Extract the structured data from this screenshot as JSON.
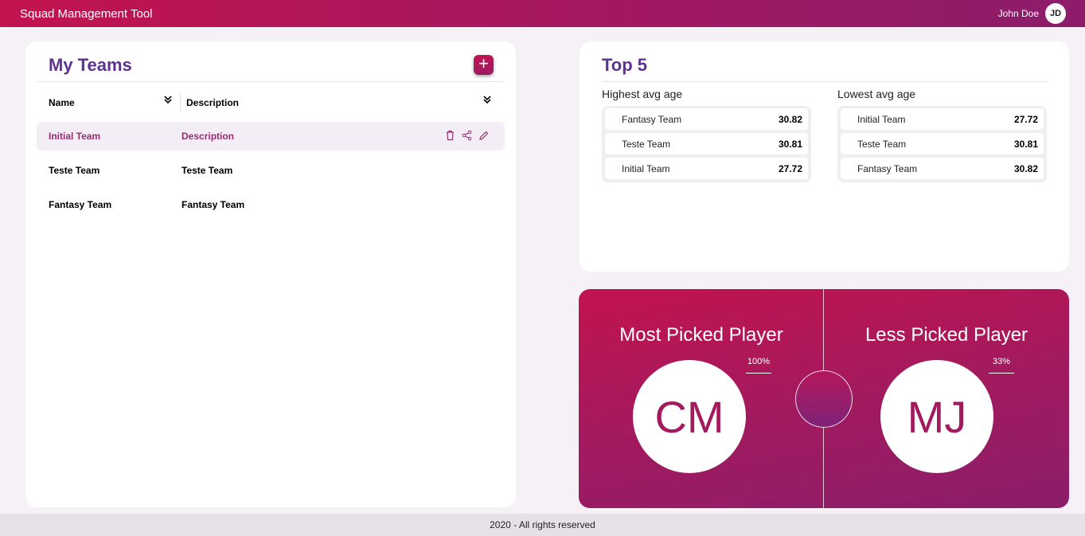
{
  "header": {
    "app_title": "Squad Management Tool",
    "user_name": "John Doe",
    "user_initials": "JD"
  },
  "my_teams": {
    "title": "My Teams",
    "add_label": "+",
    "columns": [
      "Name",
      "Description"
    ],
    "rows": [
      {
        "name": "Initial Team",
        "description": "Description"
      },
      {
        "name": "Teste Team",
        "description": "Teste Team"
      },
      {
        "name": "Fantasy Team",
        "description": "Fantasy Team"
      }
    ]
  },
  "top5": {
    "title": "Top 5",
    "highest": {
      "label": "Highest avg age",
      "items": [
        {
          "name": "Fantasy Team",
          "value": "30.82"
        },
        {
          "name": "Teste Team",
          "value": "30.81"
        },
        {
          "name": "Initial Team",
          "value": "27.72"
        }
      ]
    },
    "lowest": {
      "label": "Lowest avg age",
      "items": [
        {
          "name": "Initial Team",
          "value": "27.72"
        },
        {
          "name": "Teste Team",
          "value": "30.81"
        },
        {
          "name": "Fantasy Team",
          "value": "30.82"
        }
      ]
    }
  },
  "picked": {
    "most": {
      "title": "Most Picked Player",
      "initials": "CM",
      "percent": "100%"
    },
    "less": {
      "title": "Less Picked Player",
      "initials": "MJ",
      "percent": "33%"
    }
  },
  "footer": {
    "text": "2020 - All rights reserved"
  },
  "colors": {
    "accent": "#c2134f",
    "accent_dark": "#8c1c6b",
    "title_purple": "#5e3291"
  },
  "icons": [
    "plus-icon",
    "sort-icon",
    "trash-icon",
    "share-icon",
    "edit-icon"
  ]
}
